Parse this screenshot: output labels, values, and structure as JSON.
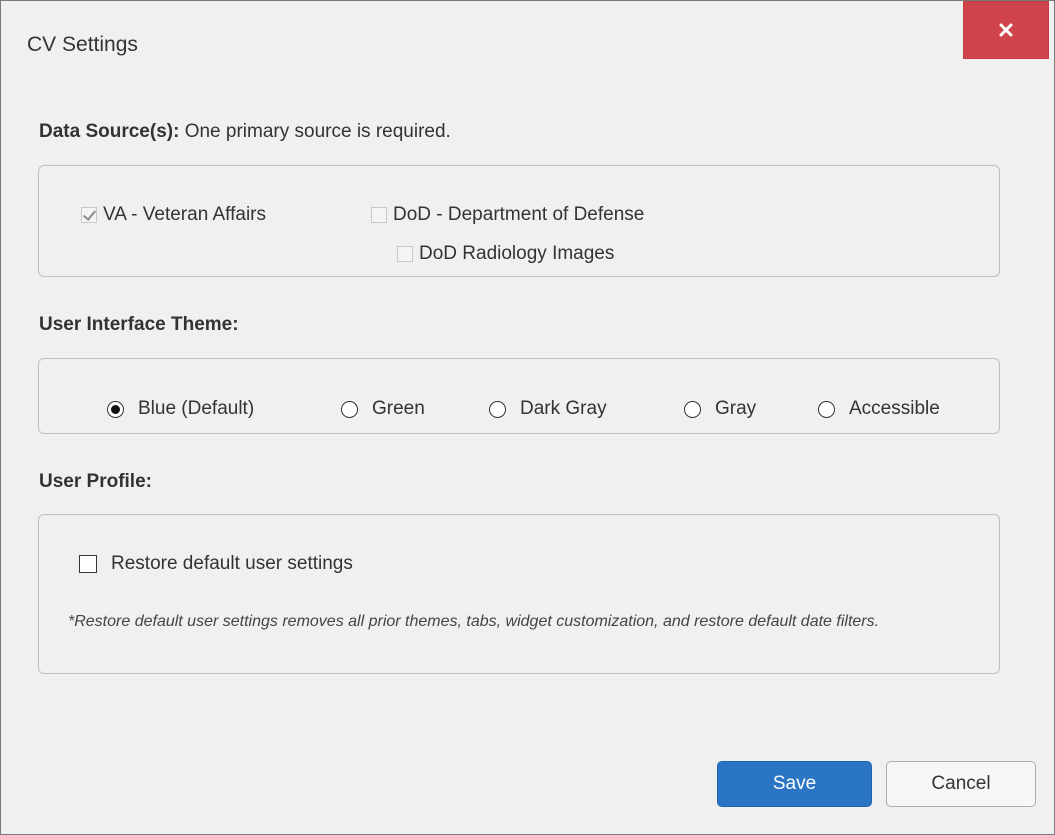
{
  "dialog": {
    "title": "CV Settings",
    "close_icon": "close-icon"
  },
  "data_sources": {
    "label_bold": "Data Source(s):",
    "label_normal": " One primary source is required.",
    "options": [
      {
        "label": "VA - Veteran Affairs",
        "checked": true,
        "disabled": true
      },
      {
        "label": "DoD - Department of Defense",
        "checked": false,
        "disabled": true
      },
      {
        "label": "DoD Radiology Images",
        "checked": false,
        "disabled": true
      }
    ]
  },
  "theme": {
    "label": "User Interface Theme:",
    "selected": "Blue (Default)",
    "options": [
      "Blue (Default)",
      "Green",
      "Dark Gray",
      "Gray",
      "Accessible"
    ]
  },
  "profile": {
    "label": "User Profile:",
    "restore_label": "Restore default user settings",
    "restore_checked": false,
    "note": "*Restore default user settings removes all prior themes, tabs, widget customization, and restore default date filters."
  },
  "buttons": {
    "save": "Save",
    "cancel": "Cancel"
  },
  "colors": {
    "close_bg": "#d0454b",
    "save_bg": "#2a76c4"
  }
}
